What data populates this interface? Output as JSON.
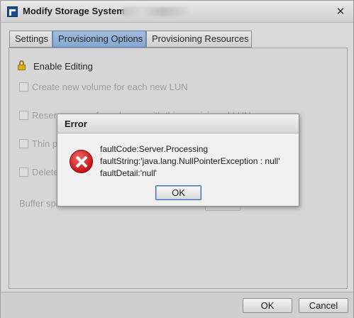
{
  "window": {
    "title": "Modify Storage System -",
    "close_glyph": "✕"
  },
  "tabs": [
    {
      "label": "Settings",
      "active": false
    },
    {
      "label": "Provisioning Options",
      "active": true
    },
    {
      "label": "Provisioning Resources",
      "active": false
    }
  ],
  "panel": {
    "enable_editing_label": "Enable Editing",
    "options": [
      {
        "label": "Create new volume for each new LUN",
        "checked": false,
        "enabled": false
      },
      {
        "label": "Reserve space for volumes with thin provisioned LUNs",
        "checked": false,
        "enabled": false
      },
      {
        "label": "Thin pr",
        "checked": false,
        "enabled": false
      },
      {
        "label": "Delete",
        "checked": false,
        "enabled": false
      }
    ],
    "buffer_label": "Buffer spa"
  },
  "footer": {
    "ok_label": "OK",
    "cancel_label": "Cancel"
  },
  "error_dialog": {
    "title": "Error",
    "icon": "error-icon",
    "lines": [
      "faultCode:Server.Processing",
      "faultString:'java.lang.NullPointerException : null'",
      "faultDetail:'null'"
    ],
    "ok_label": "OK"
  },
  "colors": {
    "active_tab": "#85aedf",
    "error_red": "#c81414",
    "disabled_text": "#a3a3a3"
  }
}
